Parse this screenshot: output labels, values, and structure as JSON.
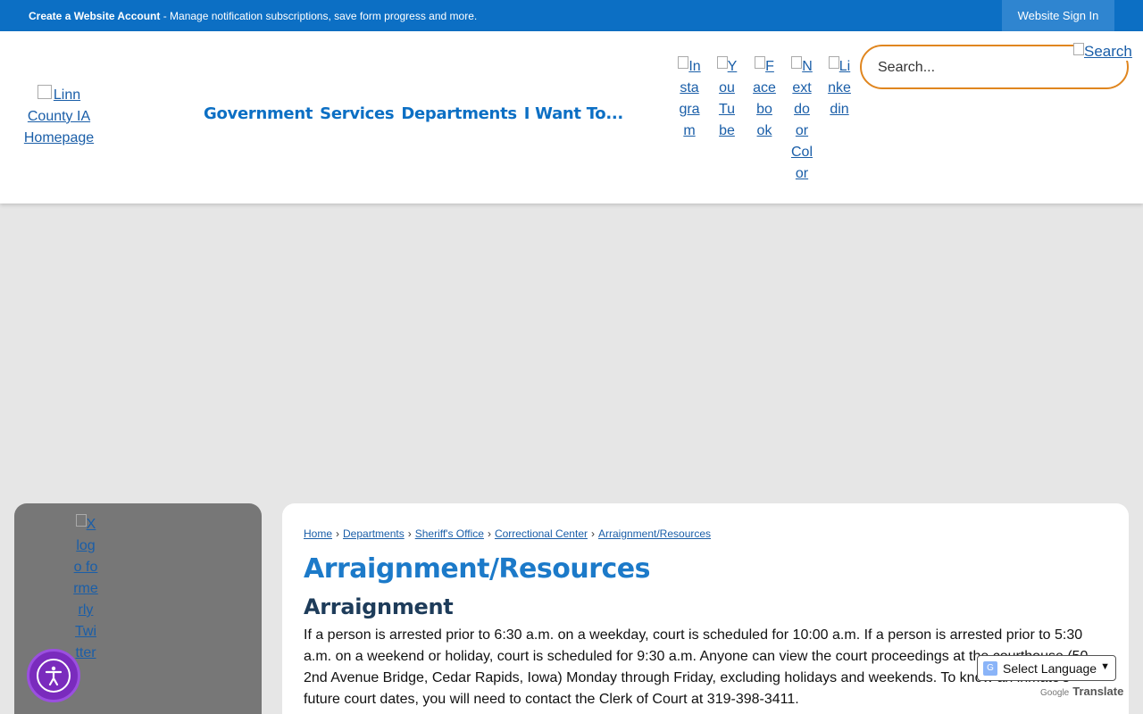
{
  "topbar": {
    "account_bold": "Create a Website Account",
    "account_rest": " - Manage notification subscriptions, save form progress and more.",
    "signin": "Website Sign In"
  },
  "header": {
    "logo_alt": "Linn County IA Homepage",
    "nav": [
      "Government",
      "Services",
      "Departments",
      "I Want To..."
    ],
    "social": [
      "Instagram",
      "YouTube",
      "Facebook",
      "Nextdoor Color",
      "Linkedin"
    ],
    "search_placeholder": "Search...",
    "search_button": "Search"
  },
  "sidebar": {
    "x_logo_alt": "X logo formerly Twitter"
  },
  "breadcrumb": [
    "Home",
    "Departments",
    "Sheriff's Office",
    "Correctional Center",
    "Arraignment/Resources"
  ],
  "main": {
    "title": "Arraignment/Resources",
    "section_title": "Arraignment",
    "paragraph": "If a person is arrested prior to 6:30 a.m. on a weekday, court is scheduled for 10:00 a.m. If a person is arrested prior to 5:30 a.m. on a weekend or holiday, court is scheduled for 9:30 a.m. Anyone can view the court proceedings at the courthouse (50 2nd Avenue Bridge, Cedar Rapids, Iowa) Monday through Friday, excluding holidays and weekends. To know an inmate's future court dates, you will need to contact the Clerk of Court at 319-398-3411."
  },
  "translate": {
    "select_label": "Select Language",
    "powered_google": "Google",
    "powered_translate": "Translate"
  },
  "icons": {
    "accessibility": "accessibility-person-icon",
    "translate": "google-translate-icon",
    "chevron": "chevron-down-icon"
  },
  "colors": {
    "topbar": "#0c6fc4",
    "nav": "#0c6fc4",
    "title": "#1c7ac9",
    "search_border": "#e0861f",
    "a11y": "#7a2bbd"
  }
}
